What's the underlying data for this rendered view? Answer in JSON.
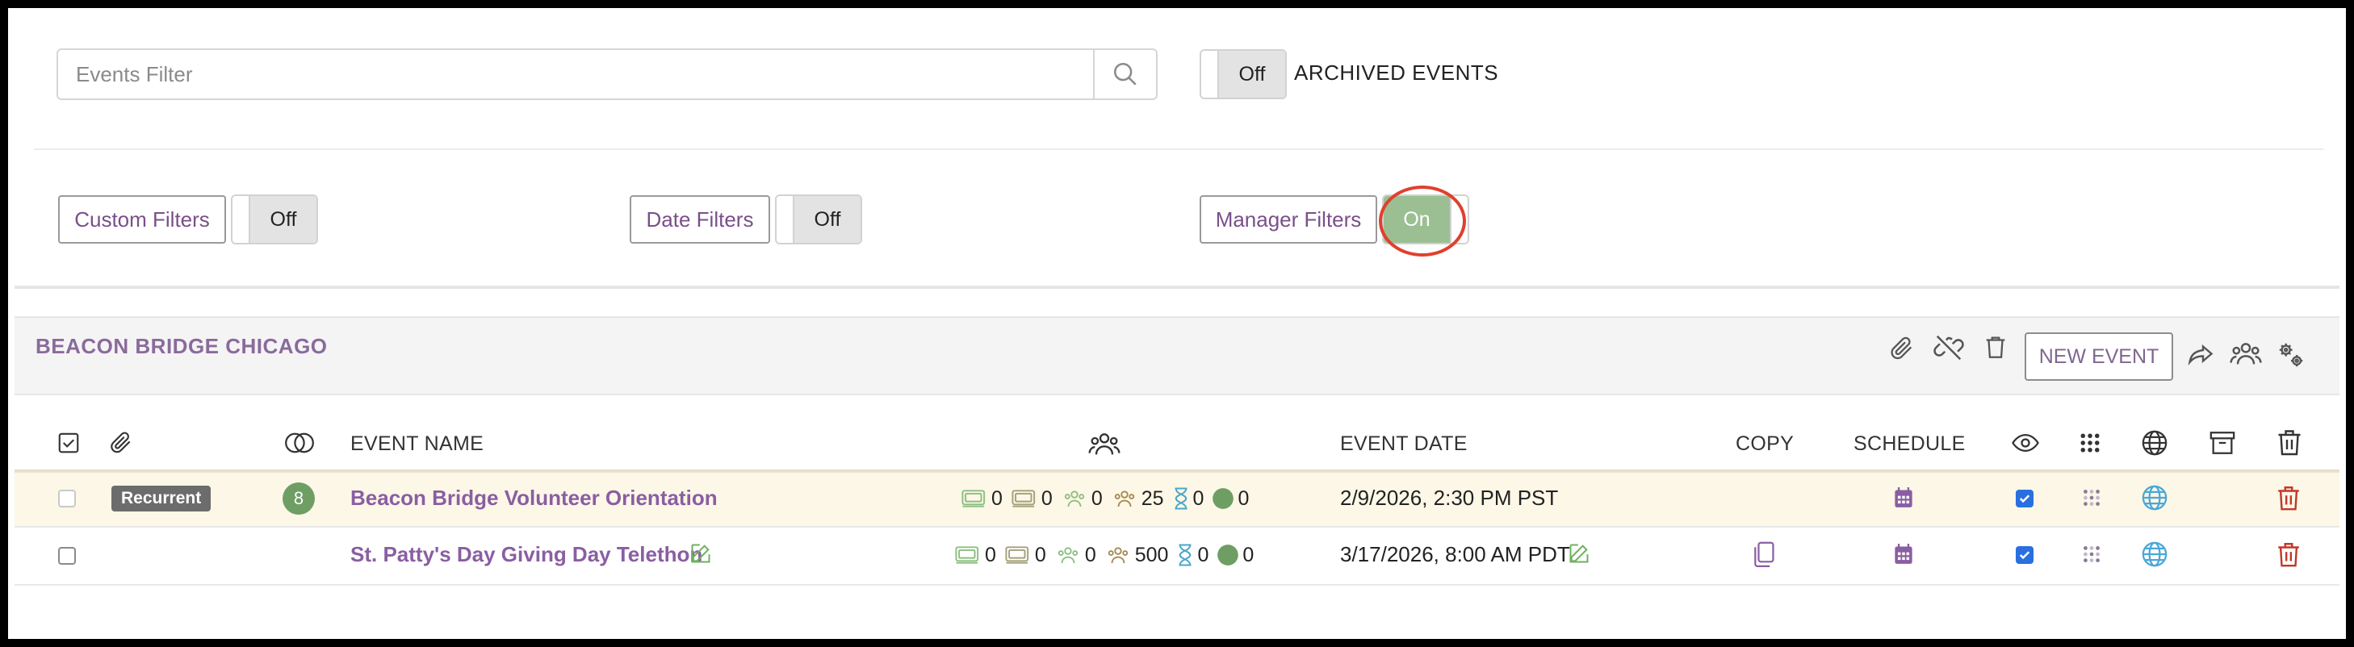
{
  "filters": {
    "search_placeholder": "Events Filter",
    "archived_toggle": "Off",
    "archived_label": "ARCHIVED EVENTS",
    "custom_filters_label": "Custom Filters",
    "custom_filters_toggle": "Off",
    "date_filters_label": "Date Filters",
    "date_filters_toggle": "Off",
    "manager_filters_label": "Manager Filters",
    "manager_filters_toggle": "On"
  },
  "org": {
    "title": "BEACON BRIDGE CHICAGO",
    "new_event_label": "NEW EVENT"
  },
  "table": {
    "headers": {
      "event_name": "EVENT NAME",
      "event_date": "EVENT DATE",
      "copy": "COPY",
      "schedule": "SCHEDULE"
    },
    "rows": [
      {
        "badge": "Recurrent",
        "count": "8",
        "name": "Beacon Bridge Volunteer Orientation",
        "stats": [
          "0",
          "0",
          "0",
          "25",
          "0",
          "0"
        ],
        "date": "2/9/2026, 2:30 PM PST"
      },
      {
        "badge": "",
        "count": "",
        "name": "St. Patty's Day Giving Day Telethon",
        "stats": [
          "0",
          "0",
          "0",
          "500",
          "0",
          "0"
        ],
        "date": "3/17/2026, 8:00 AM PDT"
      }
    ]
  },
  "colors": {
    "accent_purple": "#8a5ea2",
    "toggle_on_green": "#9bbf93",
    "delete_red": "#c0392b",
    "annotation_red": "#e0402e"
  }
}
